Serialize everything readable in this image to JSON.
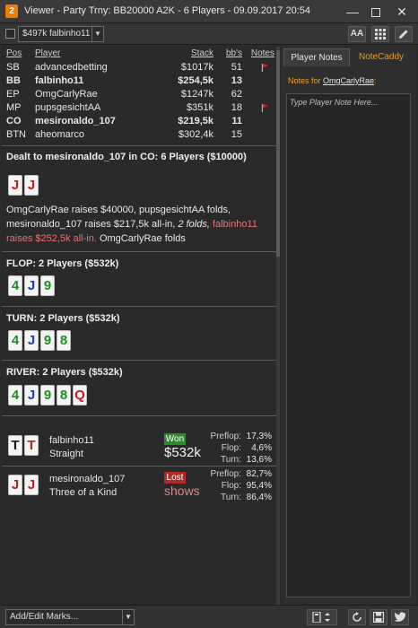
{
  "window": {
    "app_icon": "2",
    "title": "Viewer - Party Trny: BB20000 A2K - 6 Players - 09.09.2017 20:54",
    "minimize": "—",
    "close": "✕"
  },
  "toolbar": {
    "player_select": "$497k falbinho11",
    "font_button": "AA",
    "grid_icon": "grid-icon",
    "pen_icon": "pencil-icon"
  },
  "players_table": {
    "headers": {
      "pos": "Pos",
      "player": "Player",
      "stack": "Stack",
      "bbs": "bb's",
      "notes": "Notes"
    },
    "rows": [
      {
        "pos": "SB",
        "player": "advancedbetting",
        "stack": "$1017k",
        "bbs": "51",
        "flag": true,
        "bold": false
      },
      {
        "pos": "BB",
        "player": "falbinho11",
        "stack": "$254,5k",
        "bbs": "13",
        "flag": false,
        "bold": true
      },
      {
        "pos": "EP",
        "player": "OmgCarlyRae",
        "stack": "$1247k",
        "bbs": "62",
        "flag": false,
        "bold": false
      },
      {
        "pos": "MP",
        "player": "pupsgesichtAA",
        "stack": "$351k",
        "bbs": "18",
        "flag": true,
        "bold": false
      },
      {
        "pos": "CO",
        "player": "mesironaldo_107",
        "stack": "$219,5k",
        "bbs": "11",
        "flag": false,
        "bold": true
      },
      {
        "pos": "BTN",
        "player": "aheomarco",
        "stack": "$302,4k",
        "bbs": "15",
        "flag": false,
        "bold": false
      }
    ],
    "flag_color": "#e02020"
  },
  "preflop": {
    "header": "Dealt to mesironaldo_107 in CO: 6 Players ($10000)",
    "hole_cards": [
      {
        "rank": "J",
        "suit": "h"
      },
      {
        "rank": "J",
        "suit": "h"
      }
    ],
    "action_part1": "OmgCarlyRae raises $40000, pupsgesichtAA folds, mesironaldo_107 raises $217,5k all-in,",
    "action_folds": "2 folds,",
    "action_red": "falbinho11 raises $252,5k all-in.",
    "action_end": "OmgCarlyRae folds"
  },
  "flop": {
    "header": "FLOP: 2 Players ($532k)",
    "cards": [
      {
        "rank": "4",
        "suit": "c"
      },
      {
        "rank": "J",
        "suit": "d"
      },
      {
        "rank": "9",
        "suit": "c"
      }
    ]
  },
  "turn": {
    "header": "TURN: 2 Players ($532k)",
    "cards": [
      {
        "rank": "4",
        "suit": "c"
      },
      {
        "rank": "J",
        "suit": "d"
      },
      {
        "rank": "9",
        "suit": "c"
      },
      {
        "rank": "8",
        "suit": "c"
      }
    ]
  },
  "river": {
    "header": "RIVER: 2 Players ($532k)",
    "cards": [
      {
        "rank": "4",
        "suit": "c"
      },
      {
        "rank": "J",
        "suit": "d"
      },
      {
        "rank": "9",
        "suit": "c"
      },
      {
        "rank": "8",
        "suit": "c"
      },
      {
        "rank": "Q",
        "suit": "h"
      }
    ]
  },
  "results": [
    {
      "cards": [
        {
          "rank": "T",
          "suit": "s"
        },
        {
          "rank": "T",
          "suit": "h"
        }
      ],
      "player": "falbinho11",
      "hand": "Straight",
      "badge": "Won",
      "amount": "$532k",
      "equity": {
        "preflop_label": "Preflop:",
        "preflop": "17,3%",
        "flop_label": "Flop:",
        "flop": "4,6%",
        "turn_label": "Turn:",
        "turn": "13,6%"
      }
    },
    {
      "cards": [
        {
          "rank": "J",
          "suit": "h"
        },
        {
          "rank": "J",
          "suit": "h"
        }
      ],
      "player": "mesironaldo_107",
      "hand": "Three of a Kind",
      "badge": "Lost",
      "amount": "shows",
      "equity": {
        "preflop_label": "Preflop:",
        "preflop": "82,7%",
        "flop_label": "Flop:",
        "flop": "95,4%",
        "turn_label": "Turn:",
        "turn": "86,4%"
      }
    }
  ],
  "right_panel": {
    "tab_notes": "Player Notes",
    "tab_caddy": "NoteCaddy",
    "notes_for_label": "Notes for",
    "notes_player": "OmgCarlyRae",
    "notes_placeholder": "Type Player Note Here..."
  },
  "bottom": {
    "marks_select": "Add/Edit Marks...",
    "calc_icon": "calculator-icon",
    "reload_icon": "reload-icon",
    "save_icon": "save-icon",
    "tweet_icon": "twitter-icon"
  }
}
